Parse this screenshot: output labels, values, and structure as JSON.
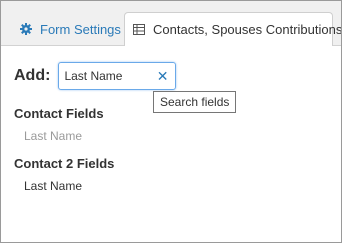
{
  "tabs": {
    "form_settings": {
      "label": "Form Settings",
      "icon": "gear-icon"
    },
    "contacts": {
      "label": "Contacts, Spouses Contributions",
      "icon": "table-grid-icon"
    }
  },
  "add": {
    "label": "Add:",
    "search_value": "Last Name",
    "clear_icon": "close-icon",
    "tooltip": "Search fields"
  },
  "sections": [
    {
      "title": "Contact Fields",
      "items": [
        {
          "label": "Last Name",
          "state": "disabled"
        }
      ]
    },
    {
      "title": "Contact 2 Fields",
      "items": [
        {
          "label": "Last Name",
          "state": "enabled"
        }
      ]
    }
  ],
  "colors": {
    "accent": "#2a7ab8",
    "input_border": "#6aa9e9",
    "disabled_text": "#9a9a9a",
    "text": "#333333"
  }
}
